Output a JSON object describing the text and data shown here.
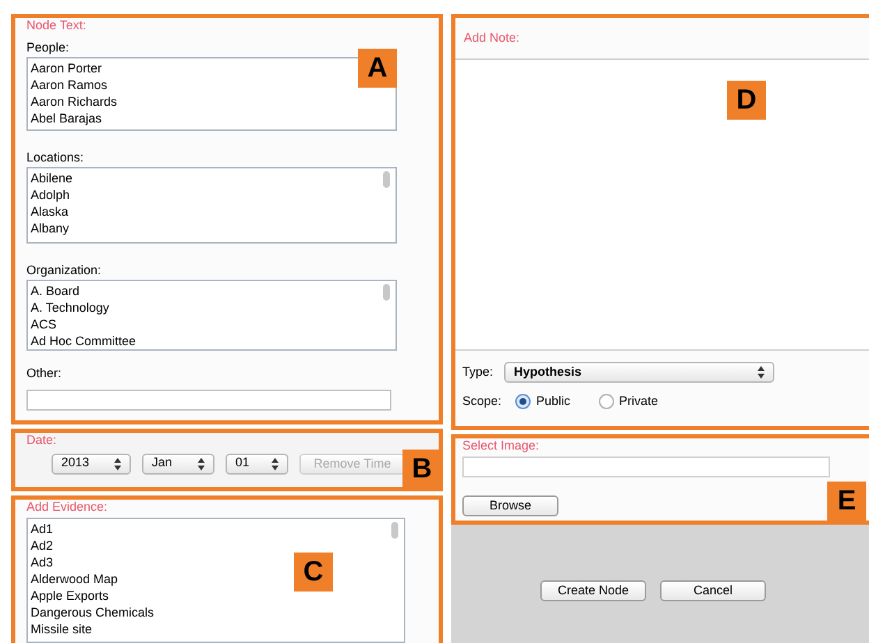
{
  "node_text": {
    "title": "Node Text:",
    "callout": "A",
    "lists": [
      {
        "label": "People:",
        "items": [
          "Aaron Porter",
          "Aaron Ramos",
          "Aaron Richards",
          "Abel Barajas"
        ]
      },
      {
        "label": "Locations:",
        "items": [
          "Abilene",
          "Adolph",
          "Alaska",
          "Albany"
        ]
      },
      {
        "label": "Organization:",
        "items": [
          "A. Board",
          "A. Technology",
          "ACS",
          "Ad Hoc Committee"
        ]
      }
    ],
    "other_label": "Other:"
  },
  "date": {
    "title": "Date:",
    "callout": "B",
    "year": "2013",
    "month": "Jan",
    "day": "01",
    "remove_time": {
      "label": "Remove Time",
      "disabled": true
    }
  },
  "evidence": {
    "title": "Add Evidence:",
    "callout": "C",
    "items": [
      "Ad1",
      "Ad2",
      "Ad3",
      "Alderwood Map",
      "Apple Exports",
      "Dangerous Chemicals",
      "Missile site"
    ]
  },
  "note": {
    "title": "Add Note:",
    "callout": "D",
    "type_label": "Type:",
    "type_value": "Hypothesis",
    "scope_label": "Scope:",
    "scope_options": [
      {
        "label": "Public",
        "selected": true
      },
      {
        "label": "Private",
        "selected": false
      }
    ]
  },
  "image": {
    "title": "Select Image:",
    "callout": "E",
    "browse": "Browse"
  },
  "buttons": [
    "Create Node",
    "Cancel"
  ]
}
